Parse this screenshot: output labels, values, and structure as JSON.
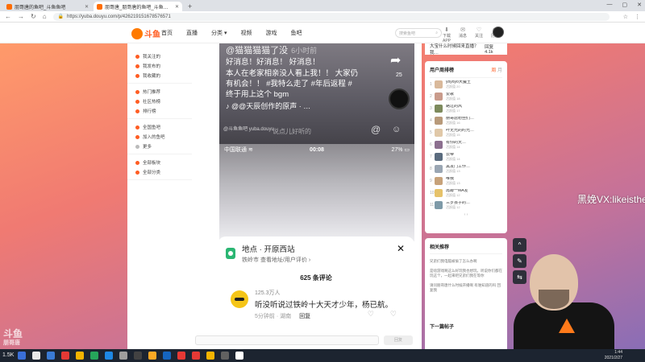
{
  "browser": {
    "tabs": [
      {
        "title": "朋哥唐的鱼吧_斗鱼鱼吧",
        "active": false
      },
      {
        "title": "朋哥唐_朋哥唐的鱼吧_斗鱼鱼吧",
        "active": true
      }
    ],
    "new_tab": "+",
    "window_controls": [
      "—",
      "▢",
      "✕"
    ],
    "url": "https://yuba.douyu.com/p/426219151678576571",
    "nav": [
      "←",
      "→",
      "↻",
      "⌂"
    ],
    "right_icons": [
      "☆",
      "⋮"
    ]
  },
  "header": {
    "logo": "斗鱼",
    "nav": [
      "首页",
      "直播",
      "分类 ▾",
      "视频",
      "游戏",
      "鱼吧"
    ],
    "search_placeholder": "搜索鱼吧",
    "search_icon": "search-icon",
    "icons": [
      {
        "glyph": "⬇",
        "label": "下载APP"
      },
      {
        "glyph": "✉",
        "label": "消息"
      },
      {
        "glyph": "♡",
        "label": "关注"
      },
      {
        "glyph": "◷",
        "label": "历史"
      }
    ]
  },
  "leftnav": {
    "groups": [
      [
        "我关注的",
        "我发布的",
        "我收藏的"
      ],
      [
        "热门推荐",
        "社区热榜",
        "排行榜"
      ],
      [
        "全国鱼吧",
        "加入的鱼吧",
        "更多"
      ],
      [
        "全部板块",
        "全部分类"
      ]
    ]
  },
  "video1": {
    "user": "@猫猫猫猫了没",
    "time": "6小时前",
    "lines": [
      "好消息！好消息！ 好消息！",
      "本人在老家相亲没人看上我！！ 大家仍",
      "有机会！！ #我特么走了 #年后返程 #",
      "终于用上这个 bgm"
    ],
    "music": "♪ @@天辰创作的原声 · …",
    "share_icon": "share-arrow-icon",
    "share_count": "25",
    "watermark": "@斗鱼鱼吧 yuba.douyu",
    "hint": "说点儿好听的"
  },
  "video2": {
    "carrier": "中国联通 ≋",
    "clock": "00:08",
    "battery": "27% ▭"
  },
  "sheet": {
    "loc_title": "地点 · 开原西站",
    "loc_sub": "铁岭市 查看地址/用户评价 ›",
    "comment_count": "625 条评论",
    "comment": {
      "name": "125.3万人",
      "text": "听没听说过铁岭十大天才少年，杨已航。",
      "meta": "5分钟前 · 湖南",
      "reply": "回复"
    }
  },
  "replybar": {
    "button": "回复"
  },
  "right": {
    "top_text": "大宝什么时候回来直播？我…",
    "top_count": "回复 4.1k",
    "rank_title": "用户周排榜",
    "rank_tabs": [
      "周",
      "月"
    ],
    "rank": [
      {
        "no": "1",
        "name": "yoyoyo大魔王",
        "lv": "活跃值 20",
        "color": "#d9b99b"
      },
      {
        "no": "2",
        "name": "爱歌",
        "lv": "活跃值 18",
        "color": "#c99b8b"
      },
      {
        "no": "3",
        "name": "路过的风",
        "lv": "活跃值 17",
        "color": "#7d8a5c"
      },
      {
        "no": "4",
        "name": "朋哥唐粉丝们…",
        "lv": "活跃值 16",
        "color": "#b89a7a"
      },
      {
        "no": "5",
        "name": "叶无光的时光…",
        "lv": "活跃值 15",
        "color": "#e0c8a8"
      },
      {
        "no": "6",
        "name": "有你的天…",
        "lv": "活跃值 14",
        "color": "#8c6f8f"
      },
      {
        "no": "7",
        "name": "云帝",
        "lv": "活跃值 14",
        "color": "#5a6b7e"
      },
      {
        "no": "8",
        "name": "黑发门工作…",
        "lv": "活跃值 13",
        "color": "#9aa6b3"
      },
      {
        "no": "9",
        "name": "唯我",
        "lv": "活跃值 13",
        "color": "#c7a27a"
      },
      {
        "no": "10",
        "name": "再蹲一MA发",
        "lv": "活跃值 12",
        "color": "#e6c26a"
      },
      {
        "no": "11",
        "name": "三岁孩子的…",
        "lv": "活跃值 12",
        "color": "#7e9aa8"
      }
    ],
    "rank_pager": "‹   ›",
    "related_title": "相关推荐",
    "related": [
      "兄弟们我电脑被偷了怎么办啊",
      "是啥游戏啊这么好玩我也想玩。听说你们都在玩这个，一起来吧兄弟们我在等你",
      "请问朋哥唐什么时候开播啊 有谁知道的吗 回复我"
    ],
    "next_title": "下一篇帖子"
  },
  "float_tools": [
    "^",
    "✎",
    "⇆"
  ],
  "overlay_text": "黑娩VX:likeisthe",
  "watermark": {
    "main": "斗鱼",
    "sub": "朋哥唐"
  },
  "taskbar": {
    "stat": "1.5K",
    "clock_time": "1:44",
    "clock_date": "2021/2/27",
    "icons": [
      "#3a6fd8",
      "#e8e8e8",
      "#3a7bd5",
      "#e53935",
      "#f4b400",
      "#26a65b",
      "#1e88e5",
      "#9e9e9e",
      "#424242",
      "#f9a825",
      "#1565c0",
      "#e53935",
      "#e53935",
      "#f4b400",
      "#616161",
      "#ffffff"
    ]
  }
}
